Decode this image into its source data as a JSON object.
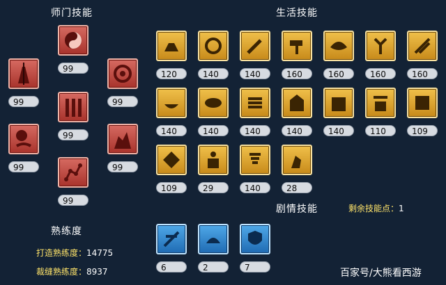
{
  "sections": {
    "master": "师门技能",
    "life": "生活技能",
    "story": "剧情技能",
    "proficiency": "熟练度"
  },
  "remaining": {
    "label": "剩余技能点：",
    "value": "1"
  },
  "proficiency": {
    "forge_label": "打造熟练度：",
    "forge_value": "14775",
    "sew_label": "裁缝熟练度：",
    "sew_value": "8937"
  },
  "master_skills": [
    {
      "icon": "yin-yang-icon",
      "level": "99"
    },
    {
      "icon": "spear-warrior-icon",
      "level": "99"
    },
    {
      "icon": "spiral-icon",
      "level": "99"
    },
    {
      "icon": "pillar-icon",
      "level": "99"
    },
    {
      "icon": "sun-moon-icon",
      "level": "99"
    },
    {
      "icon": "demon-icon",
      "level": "99"
    },
    {
      "icon": "star-chain-icon",
      "level": "99"
    }
  ],
  "life_skills": [
    {
      "icon": "forge-icon",
      "level": "120"
    },
    {
      "icon": "compass-icon",
      "level": "140"
    },
    {
      "icon": "dagger-icon",
      "level": "140"
    },
    {
      "icon": "hammer-icon",
      "level": "160"
    },
    {
      "icon": "bird-icon",
      "level": "160"
    },
    {
      "icon": "herb-icon",
      "level": "160"
    },
    {
      "icon": "stitch-icon",
      "level": "160"
    },
    {
      "icon": "bowl-icon",
      "level": "140"
    },
    {
      "icon": "eye-icon",
      "level": "140"
    },
    {
      "icon": "scroll-icon",
      "level": "140"
    },
    {
      "icon": "temple-icon",
      "level": "140"
    },
    {
      "icon": "gate-icon",
      "level": "140"
    },
    {
      "icon": "well-icon",
      "level": "110"
    },
    {
      "icon": "book-icon",
      "level": "109"
    },
    {
      "icon": "gem-icon",
      "level": "109"
    },
    {
      "icon": "strongman-icon",
      "level": "29"
    },
    {
      "icon": "whirlwind-icon",
      "level": "140"
    },
    {
      "icon": "kneel-icon",
      "level": "28"
    }
  ],
  "story_skills": [
    {
      "icon": "rune-icon",
      "level": "6"
    },
    {
      "icon": "cloud-icon",
      "level": "2"
    },
    {
      "icon": "shield-icon",
      "level": "7"
    }
  ],
  "watermark": "百家号/大熊看西游"
}
